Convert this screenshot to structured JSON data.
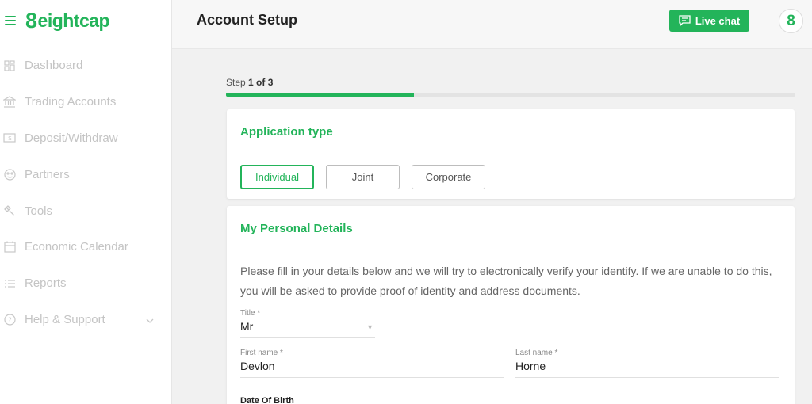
{
  "brand": {
    "name": "eightcap",
    "logo_digit": "8",
    "accent_color": "#23b45a"
  },
  "sidebar": {
    "items": [
      {
        "label": "Dashboard",
        "icon": "dashboard-icon"
      },
      {
        "label": "Trading Accounts",
        "icon": "bank-icon"
      },
      {
        "label": "Deposit/Withdraw",
        "icon": "money-icon"
      },
      {
        "label": "Partners",
        "icon": "partners-icon"
      },
      {
        "label": "Tools",
        "icon": "wrench-icon"
      },
      {
        "label": "Economic Calendar",
        "icon": "calendar-icon"
      },
      {
        "label": "Reports",
        "icon": "list-icon"
      },
      {
        "label": "Help & Support",
        "icon": "help-icon"
      }
    ]
  },
  "header": {
    "title": "Account Setup",
    "live_chat_label": "Live chat",
    "user_badge": "8"
  },
  "stepper": {
    "prefix": "Step",
    "current": "1 of 3",
    "progress": 0.33
  },
  "application_type": {
    "title": "Application type",
    "options": [
      "Individual",
      "Joint",
      "Corporate"
    ],
    "selected": "Individual"
  },
  "personal_details": {
    "title": "My Personal Details",
    "description": "Please fill in your details below and we will try to electronically verify your identify. If we are unable to do this, you will be asked to provide proof of identity and address documents.",
    "title_field": {
      "label": "Title *",
      "value": "Mr"
    },
    "first_name": {
      "label": "First name *",
      "value": "Devlon"
    },
    "last_name": {
      "label": "Last name *",
      "value": "Horne"
    },
    "dob_label": "Date Of Birth"
  }
}
